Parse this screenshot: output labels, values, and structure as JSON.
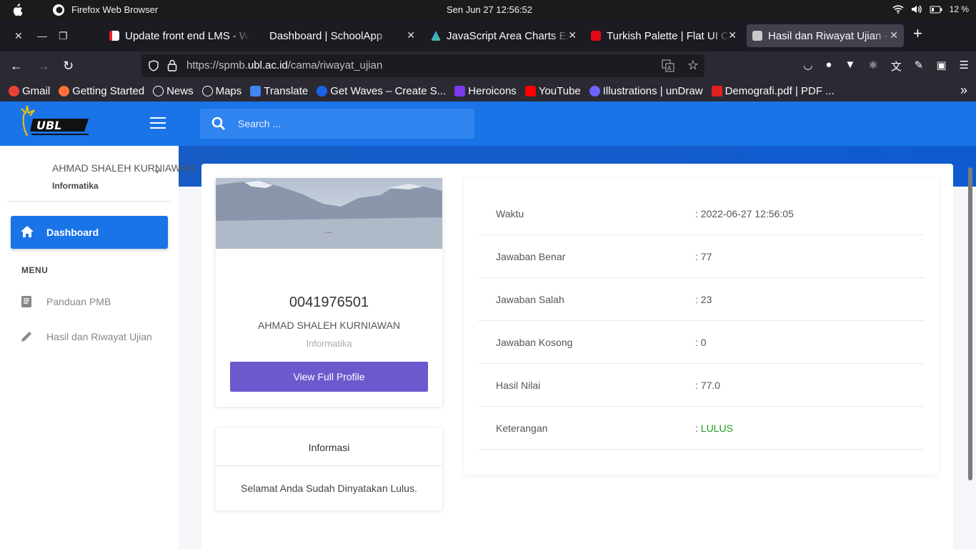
{
  "os": {
    "app_name": "Firefox Web Browser",
    "clock": "Sen Jun 27   12:56:52",
    "battery": "12 %"
  },
  "tabs": [
    {
      "title": "Update front end LMS - W",
      "active": false
    },
    {
      "title": "Dashboard | SchoolApp",
      "active": false
    },
    {
      "title": "JavaScript Area Charts Ex",
      "active": false
    },
    {
      "title": "Turkish Palette | Flat UI Co",
      "active": false
    },
    {
      "title": "Hasil dan Riwayat Ujian - S",
      "active": true
    }
  ],
  "url": {
    "prefix": "https://spmb.",
    "domain": "ubl.ac.id",
    "path": "/cama/riwayat_ujian"
  },
  "bookmarks": [
    {
      "label": "Gmail",
      "color": "#ea4335"
    },
    {
      "label": "Getting Started",
      "color": "#ff7139"
    },
    {
      "label": "News",
      "color": "#fbfbfe"
    },
    {
      "label": "Maps",
      "color": "#fbfbfe"
    },
    {
      "label": "Translate",
      "color": "#4285f4"
    },
    {
      "label": "Get Waves – Create S...",
      "color": "#1a63e8"
    },
    {
      "label": "Heroicons",
      "color": "#7c3aed"
    },
    {
      "label": "YouTube",
      "color": "#ff0000"
    },
    {
      "label": "Illustrations | unDraw",
      "color": "#6c63ff"
    },
    {
      "label": "Demografi.pdf | PDF ...",
      "color": "#e02020"
    }
  ],
  "search": {
    "placeholder": "Search ..."
  },
  "user": {
    "name": "AHMAD SHALEH KURNIAWAN",
    "dept": "Informatika"
  },
  "sidebar": {
    "dashboard": "Dashboard",
    "menu_header": "MENU",
    "items": [
      {
        "label": "Panduan PMB",
        "icon": "book-icon"
      },
      {
        "label": "Hasil dan Riwayat Ujian",
        "icon": "pencil-icon"
      }
    ]
  },
  "profile": {
    "banner_text": "...",
    "id": "0041976501",
    "name": "AHMAD SHALEH KURNIAWAN",
    "dept": "Informatika",
    "button": "View Full Profile"
  },
  "info": {
    "title": "Informasi",
    "body": "Selamat Anda Sudah Dinyatakan Lulus."
  },
  "results": [
    {
      "key": "Waktu",
      "value": "2022-06-27 12:56:05"
    },
    {
      "key": "Jawaban Benar",
      "value": "77"
    },
    {
      "key": "Jawaban Salah",
      "value": "23"
    },
    {
      "key": "Jawaban Kosong",
      "value": "0"
    },
    {
      "key": "Hasil Nilai",
      "value": "77.0"
    },
    {
      "key": "Keterangan",
      "value": "LULUS"
    }
  ],
  "colors": {
    "primary": "#1a74e8",
    "button": "#6a5acd",
    "pass": "#1a9e1a"
  }
}
